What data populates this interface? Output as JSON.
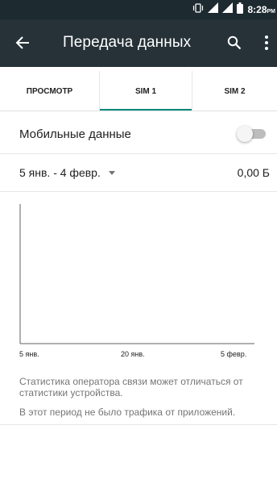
{
  "status_bar": {
    "time": "8:28",
    "time_suffix": "PM",
    "icons": [
      "vibrate-icon",
      "signal-icon",
      "signal-icon",
      "battery-icon"
    ]
  },
  "app_bar": {
    "title": "Передача данных",
    "icons": [
      "back-arrow-icon",
      "search-icon",
      "more-vert-icon"
    ],
    "colors": {
      "background": "#263238",
      "status_bar": "#1d2a30",
      "accent": "#00897b"
    }
  },
  "tabs": [
    {
      "label": "ПРОСМОТР",
      "selected": false
    },
    {
      "label": "SIM 1",
      "selected": true
    },
    {
      "label": "SIM 2",
      "selected": false
    }
  ],
  "mobile_data": {
    "label": "Мобильные данные",
    "enabled": false
  },
  "period": {
    "range": "5 янв. - 4 февр.",
    "usage": "0,00 Б"
  },
  "chart_data": {
    "type": "area",
    "x_tick_labels": [
      "5 янв.",
      "20 янв.",
      "5 февр."
    ],
    "series": [],
    "title": "",
    "xlabel": "",
    "ylabel": ""
  },
  "notes": {
    "carrier_disclaimer": "Статистика оператора связи может отличаться от статистики устройства.",
    "no_traffic": "В этот период не было трафика от приложений."
  }
}
